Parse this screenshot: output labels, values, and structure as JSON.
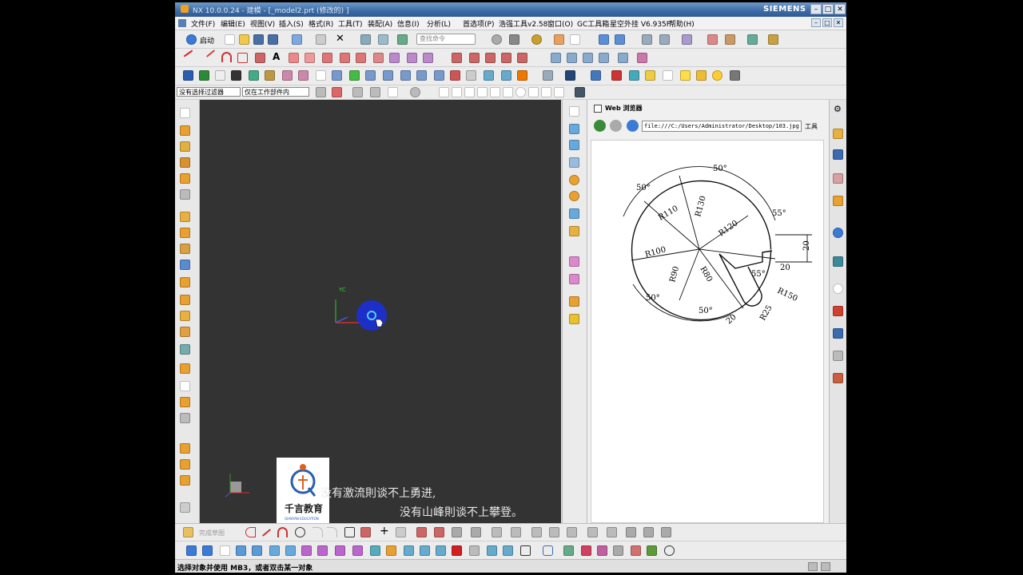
{
  "window": {
    "title": "NX 10.0.0.24 - 建模 - [_model2.prt  (修改的) ]",
    "brand": "SIEMENS",
    "controls": [
      "–",
      "□",
      "✕"
    ]
  },
  "menu": {
    "items": [
      "文件(F)",
      "编辑(E)",
      "视图(V)",
      "插入(S)",
      "格式(R)",
      "工具(T)",
      "装配(A)",
      "信息(I)",
      "分析(L)",
      "首选项(P)",
      "浩强工具v2.58",
      "窗口(O)",
      "GC工具箱",
      "星空外挂 V6.935F",
      "帮助(H)"
    ]
  },
  "toolbar": {
    "start_label": "启动",
    "search_placeholder": "查找命令",
    "filter_select": "没有选择过滤器",
    "scope_select": "仅在工作部件内"
  },
  "viewport": {
    "axis_label": "YC",
    "quote_line1": "没有激流則谈不上勇进,",
    "quote_line2": "没有山峰則谈不上攀登。",
    "logo_text": "千言教育",
    "logo_subtext": "QIANYAN EDUCATION"
  },
  "web_panel": {
    "title": "Web 浏览器",
    "url": "file:///C:/Users/Administrator/Desktop/103.jpg",
    "tools_label": "工具",
    "drawing_dims": [
      "50°",
      "50°",
      "55°",
      "R130",
      "R110",
      "R120",
      "R100",
      "20",
      "20",
      "R90",
      "R80",
      "55°",
      "R150",
      "50°",
      "50°",
      "20",
      "R25"
    ]
  },
  "bottom": {
    "sketch_label": "完成草图"
  },
  "status": {
    "text": "选择对象并使用 MB3，或者双击某一对象"
  },
  "colors": {
    "viewport_bg": "#333333",
    "titlebar": "#3b6aa5",
    "ui_bg": "#e6e6e6"
  }
}
